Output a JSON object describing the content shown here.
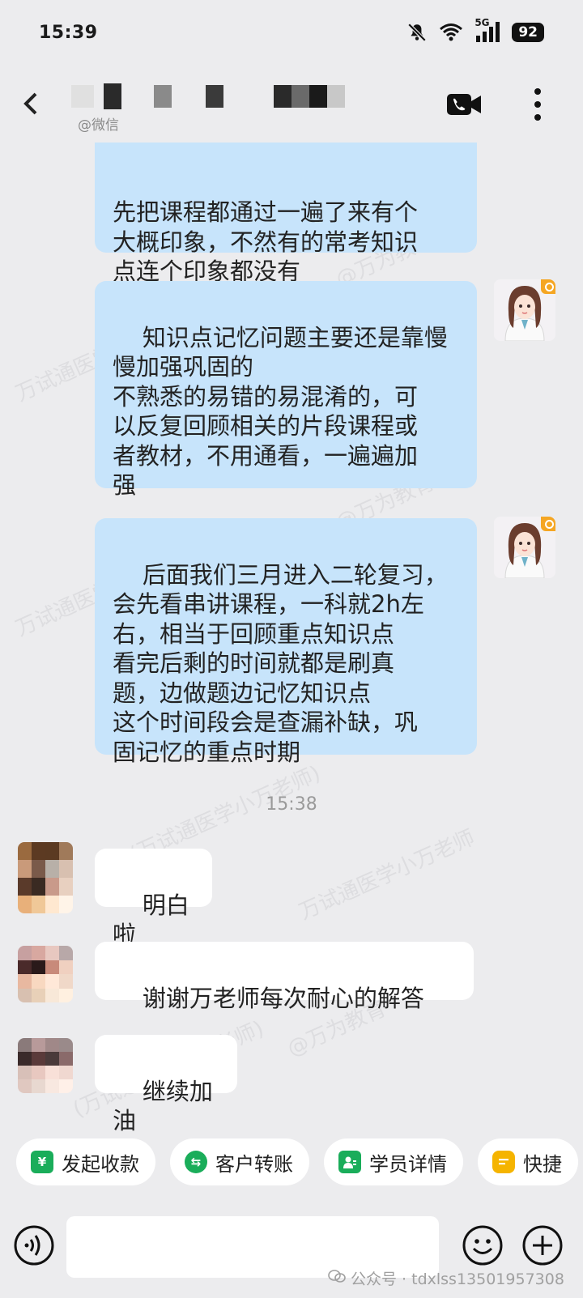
{
  "status_bar": {
    "time": "15:39",
    "signal_label": "5G",
    "battery": "92"
  },
  "header": {
    "subtitle": "@微信"
  },
  "messages": [
    {
      "text": "知识点记忆问题主要还是靠慢\n慢加强巩固的\n不熟悉的易错的易混淆的，可\n以反复回顾相关的片段课程或\n者教材，不用通看，一遍遍加\n强"
    },
    {
      "text": "后面我们三月进入二轮复习，\n会先看串讲课程，一科就2h左\n右，相当于回顾重点知识点\n看完后剩的时间就都是刷真\n题，边做题边记忆知识点\n这个时间段会是查漏补缺，巩\n固记忆的重点时期"
    },
    {
      "text": "明白啦"
    },
    {
      "text": "谢谢万老师每次耐心的解答"
    },
    {
      "text": "继续加油"
    }
  ],
  "partial_message": {
    "text": "先把课程都通过一遍了来有个\n大概印象，不然有的常考知识\n点连个印象都没有"
  },
  "timestamp": "15:38",
  "watermarks": [
    "万试通医学小万老师",
    "(万试通医学小万老师)",
    "@万为教育"
  ],
  "quick_actions": [
    {
      "label": "发起收款",
      "icon": "yen-icon",
      "color": "#1aad5a"
    },
    {
      "label": "客户转账",
      "icon": "transfer-icon",
      "color": "#1aad5a"
    },
    {
      "label": "学员详情",
      "icon": "user-card-icon",
      "color": "#1aad5a"
    },
    {
      "label": "快捷",
      "icon": "quick-reply-icon",
      "color": "#f5b400"
    }
  ],
  "input": {
    "placeholder": ""
  },
  "footer_watermark": {
    "label": "公众号 · tdxlss13501957308"
  },
  "colors": {
    "bubble_sent": "#c7e4fb",
    "bubble_received": "#ffffff",
    "background": "#ececee"
  }
}
